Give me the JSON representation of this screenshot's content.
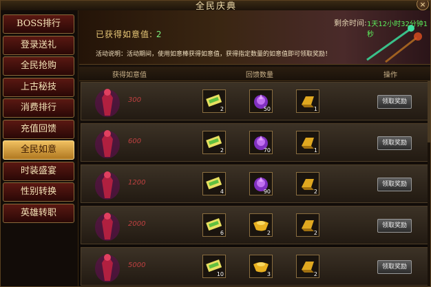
{
  "window": {
    "title": "全民庆典",
    "close_label": "×"
  },
  "sidebar": {
    "items": [
      {
        "label": "BOSS排行",
        "active": false
      },
      {
        "label": "登录送礼",
        "active": false
      },
      {
        "label": "全民抢购",
        "active": false
      },
      {
        "label": "上古秘技",
        "active": false
      },
      {
        "label": "消费排行",
        "active": false
      },
      {
        "label": "充值回馈",
        "active": false
      },
      {
        "label": "全民如意",
        "active": true
      },
      {
        "label": "时装盛宴",
        "active": false
      },
      {
        "label": "性别转换",
        "active": false
      },
      {
        "label": "英雄转职",
        "active": false
      }
    ]
  },
  "banner": {
    "obtained_label": "已获得如意值:",
    "obtained_value": "2",
    "time_label": "剩余时间:",
    "time_value": "1天12小时32分钟1秒",
    "description": "活动说明：活动期间，使用如意棒获得如意值，获得指定数量的如意值即可领取奖励！"
  },
  "table": {
    "headers": {
      "col1": "获得如意值",
      "col2": "回馈数量",
      "col3": "操作"
    },
    "rows": [
      {
        "value": "300",
        "rewards": [
          {
            "icon": "scroll-icon",
            "count": "2"
          },
          {
            "icon": "purple-orb-icon",
            "count": "50"
          },
          {
            "icon": "gold-bar-icon",
            "count": "1"
          }
        ],
        "button": "领取奖励"
      },
      {
        "value": "600",
        "rewards": [
          {
            "icon": "scroll-icon",
            "count": "2"
          },
          {
            "icon": "purple-orb-icon",
            "count": "70"
          },
          {
            "icon": "gold-bar-icon",
            "count": "1"
          }
        ],
        "button": "领取奖励"
      },
      {
        "value": "1200",
        "rewards": [
          {
            "icon": "scroll-icon",
            "count": "4"
          },
          {
            "icon": "purple-orb-icon",
            "count": "90"
          },
          {
            "icon": "gold-bar-icon",
            "count": "2"
          }
        ],
        "button": "领取奖励"
      },
      {
        "value": "2000",
        "rewards": [
          {
            "icon": "scroll-icon",
            "count": "6"
          },
          {
            "icon": "gold-ingot-icon",
            "count": "2"
          },
          {
            "icon": "gold-bar-icon",
            "count": "2"
          }
        ],
        "button": "领取奖励"
      },
      {
        "value": "5000",
        "rewards": [
          {
            "icon": "scroll-icon",
            "count": "10"
          },
          {
            "icon": "gold-ingot-icon",
            "count": "3"
          },
          {
            "icon": "gold-bar-icon",
            "count": "2"
          }
        ],
        "button": "领取奖励"
      }
    ]
  },
  "colors": {
    "active_tab": "#f0c060",
    "value_text": "#c04040",
    "timer": "#5cf05c"
  }
}
